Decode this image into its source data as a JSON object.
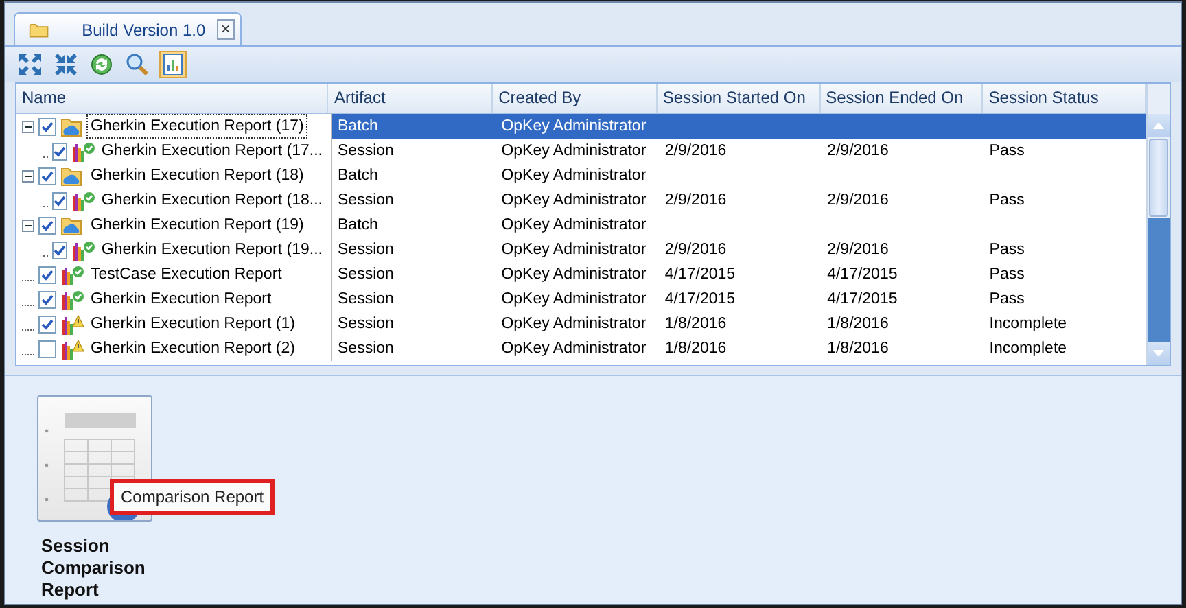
{
  "tab": {
    "title": "Build Version 1.0",
    "close": "×"
  },
  "table": {
    "columns": [
      "Name",
      "Artifact",
      "Created By",
      "Session Started On",
      "Session Ended On",
      "Session Status"
    ],
    "rows": [
      {
        "kind": "batch",
        "name": "Gherkin Execution Report (17)",
        "checked": true,
        "selected": true,
        "expanded": true,
        "artifact": "Batch",
        "created_by": "OpKey Administrator",
        "started": "",
        "ended": "",
        "status": "",
        "children": [
          {
            "kind": "passed",
            "name": "Gherkin Execution Report (17...",
            "checked": true,
            "selected": false,
            "artifact": "Session",
            "created_by": "OpKey Administrator",
            "started": "2/9/2016",
            "ended": "2/9/2016",
            "status": "Pass"
          }
        ]
      },
      {
        "kind": "batch",
        "name": "Gherkin Execution Report (18)",
        "checked": true,
        "selected": false,
        "expanded": true,
        "artifact": "Batch",
        "created_by": "OpKey Administrator",
        "started": "",
        "ended": "",
        "status": "",
        "children": [
          {
            "kind": "passed",
            "name": "Gherkin Execution Report (18...",
            "checked": true,
            "selected": false,
            "artifact": "Session",
            "created_by": "OpKey Administrator",
            "started": "2/9/2016",
            "ended": "2/9/2016",
            "status": "Pass"
          }
        ]
      },
      {
        "kind": "batch",
        "name": "Gherkin Execution Report (19)",
        "checked": true,
        "selected": false,
        "expanded": true,
        "artifact": "Batch",
        "created_by": "OpKey Administrator",
        "started": "",
        "ended": "",
        "status": "",
        "children": [
          {
            "kind": "passed",
            "name": "Gherkin Execution Report (19...",
            "checked": true,
            "selected": false,
            "artifact": "Session",
            "created_by": "OpKey Administrator",
            "started": "2/9/2016",
            "ended": "2/9/2016",
            "status": "Pass"
          }
        ]
      },
      {
        "kind": "passed",
        "name": "TestCase Execution Report",
        "checked": true,
        "selected": false,
        "artifact": "Session",
        "created_by": "OpKey Administrator",
        "started": "4/17/2015",
        "ended": "4/17/2015",
        "status": "Pass"
      },
      {
        "kind": "passed",
        "name": "Gherkin Execution Report",
        "checked": true,
        "selected": false,
        "artifact": "Session",
        "created_by": "OpKey Administrator",
        "started": "4/17/2015",
        "ended": "4/17/2015",
        "status": "Pass"
      },
      {
        "kind": "warning",
        "name": "Gherkin Execution Report (1)",
        "checked": true,
        "selected": false,
        "artifact": "Session",
        "created_by": "OpKey Administrator",
        "started": "1/8/2016",
        "ended": "1/8/2016",
        "status": "Incomplete"
      },
      {
        "kind": "warning",
        "name": "Gherkin Execution Report (2)",
        "checked": false,
        "selected": false,
        "artifact": "Session",
        "created_by": "OpKey Administrator",
        "started": "1/8/2016",
        "ended": "1/8/2016",
        "status": "Incomplete"
      }
    ]
  },
  "reports": [
    {
      "label": "Session Comparison Report",
      "tooltip": "Comparison Report"
    }
  ]
}
